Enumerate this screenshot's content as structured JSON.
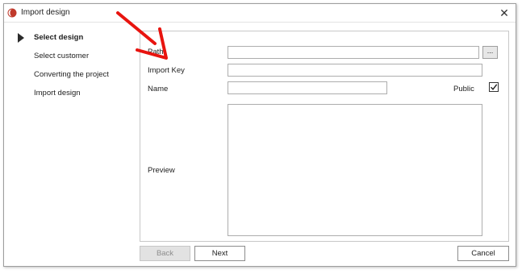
{
  "window": {
    "title": "Import design",
    "close_glyph": "✕",
    "app_icon": "app-logo-icon"
  },
  "steps": [
    {
      "label": "Select design",
      "active": true
    },
    {
      "label": "Select customer",
      "active": false
    },
    {
      "label": "Converting the project",
      "active": false
    },
    {
      "label": "Import design",
      "active": false
    }
  ],
  "form": {
    "path_label": "Path",
    "path_value": "",
    "browse_label": "...",
    "import_key_label": "Import Key",
    "import_key_value": "",
    "name_label": "Name",
    "name_value": "",
    "public_label": "Public",
    "public_checked": true,
    "preview_label": "Preview"
  },
  "buttons": {
    "back": "Back",
    "next": "Next",
    "cancel": "Cancel"
  },
  "colors": {
    "annotation_arrow": "#e8140f",
    "app_icon": "#c0392b"
  }
}
